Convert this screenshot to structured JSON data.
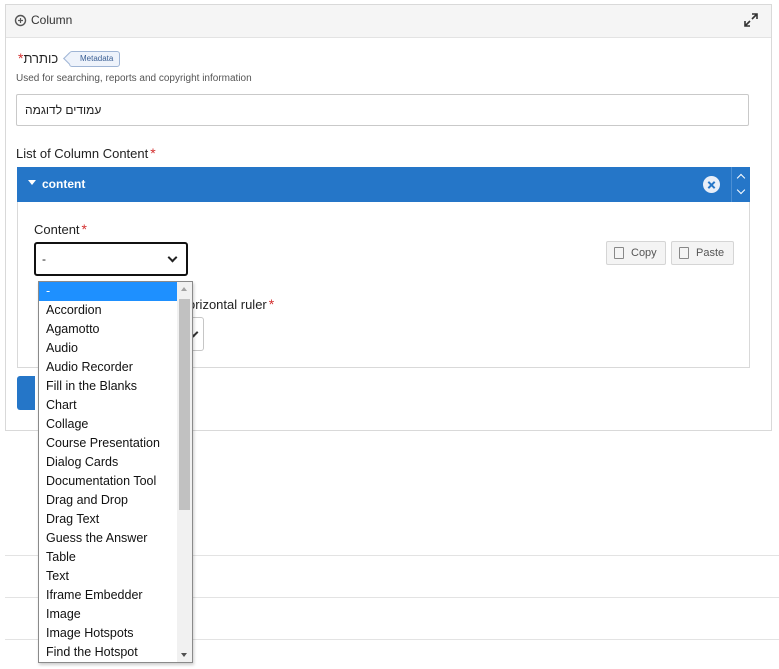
{
  "panel": {
    "title": "Column",
    "icon": "column-icon",
    "expand_icon": "expand-icon"
  },
  "title_field": {
    "label": "כותרת",
    "required_mark": "*",
    "badge": "Metadata",
    "help": "Used for searching, reports and copyright information",
    "value": "עמודים לדוגמה"
  },
  "list": {
    "label": "List of Column Content",
    "required_mark": "*",
    "item": {
      "name": "content",
      "content_label": "Content",
      "required_mark": "*",
      "selected": "-",
      "copy_label": "Copy",
      "paste_label": "Paste",
      "ruler_label": "orizontal ruler",
      "ruler_required": "*"
    }
  },
  "dropdown": {
    "options": [
      "-",
      "Accordion",
      "Agamotto",
      "Audio",
      "Audio Recorder",
      "Fill in the Blanks",
      "Chart",
      "Collage",
      "Course Presentation",
      "Dialog Cards",
      "Documentation Tool",
      "Drag and Drop",
      "Drag Text",
      "Guess the Answer",
      "Table",
      "Text",
      "Iframe Embedder",
      "Image",
      "Image Hotspots",
      "Find the Hotspot"
    ],
    "selected_index": 0
  },
  "colors": {
    "accent": "#2576c8",
    "selected_option": "#1e90ff",
    "required": "#d32f2f"
  }
}
